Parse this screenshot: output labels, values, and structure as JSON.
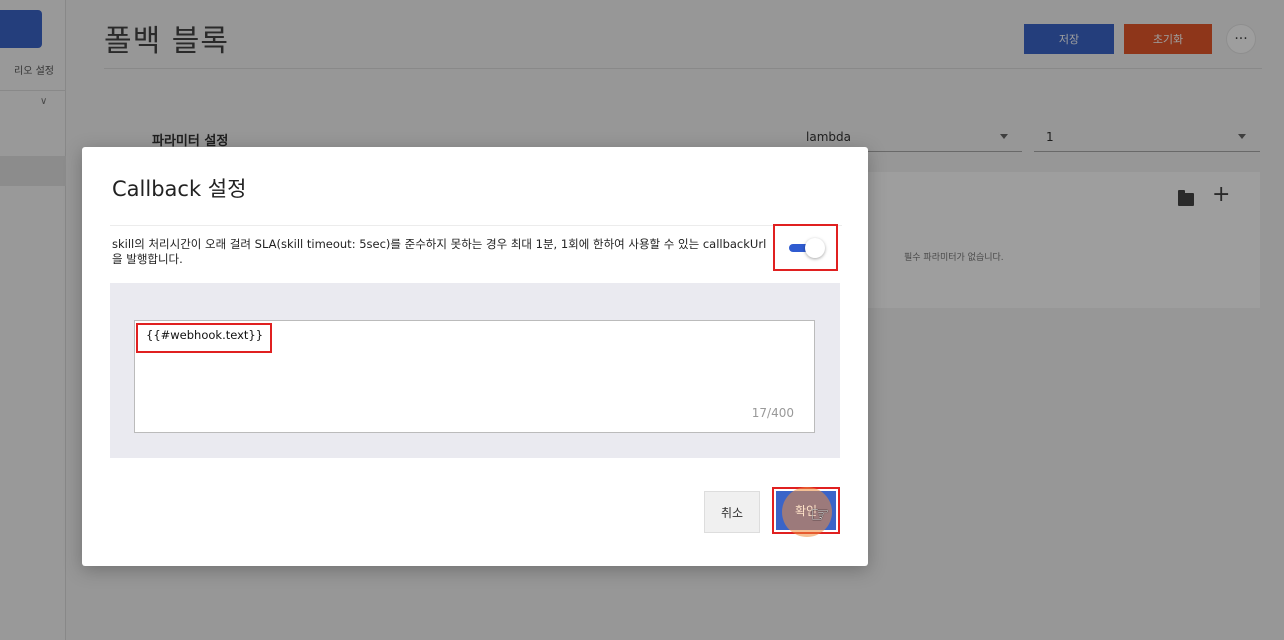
{
  "app": {
    "sidebar": {
      "partial_label": "리오 설정"
    },
    "page_title": "폴백 블록",
    "toolbar": {
      "save_label": "저장",
      "reset_label": "초기화",
      "more_icon": "more-horizontal-icon",
      "more_label": "···"
    },
    "parameters": {
      "label": "파라미터 설정",
      "select_1_value": "lambda",
      "select_2_value": "1",
      "empty_text": "필수 파라미터가 없습니다.",
      "add_label": "+"
    }
  },
  "modal": {
    "title": "Callback 설정",
    "description": "skill의 처리시간이 오래 걸려 SLA(skill timeout: 5sec)를 준수하지 못하는 경우 최대 1분, 1회에 한하여 사용할 수 있는 callbackUrl을 발행합니다.",
    "toggle_on": true,
    "textarea_value": "{{#webhook.text}}",
    "counter": "17/400",
    "cancel_label": "취소",
    "confirm_label": "확인"
  },
  "colors": {
    "primary": "#3a64c8",
    "danger": "#e5582b",
    "highlight": "#e02020"
  }
}
